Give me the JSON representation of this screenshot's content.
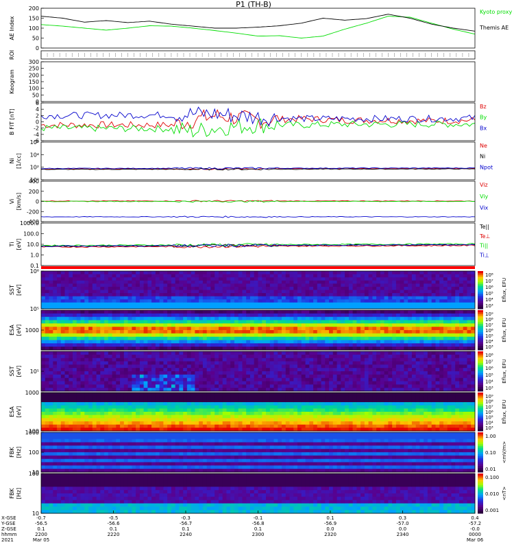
{
  "title": "P1 (TH-B)",
  "colors": {
    "kyoto": "#00dd00",
    "themis": "#000000",
    "red": "#dd0000",
    "green": "#00dd00",
    "blue": "#0000cc"
  },
  "time_axis": {
    "rows": [
      {
        "label": "X-GSE",
        "values": [
          "-0.7",
          "-0.5",
          "-0.3",
          "-0.1",
          "0.1",
          "0.3",
          "0.4"
        ]
      },
      {
        "label": "Y-GSE",
        "values": [
          "-56.5",
          "-56.6",
          "-56.7",
          "-56.8",
          "-56.9",
          "-57.0",
          "-57.2"
        ]
      },
      {
        "label": "Z-GSE",
        "values": [
          "0.1",
          "0.1",
          "0.1",
          "0.1",
          "0.0",
          "0.0",
          "-0.0"
        ]
      },
      {
        "label": "hhmm",
        "values": [
          "2200",
          "2220",
          "2240",
          "2300",
          "2320",
          "2340",
          "0000"
        ]
      },
      {
        "label": "2021",
        "values": [
          "Mar 05",
          "",
          "",
          "",
          "",
          "",
          "Mar 06"
        ]
      }
    ]
  },
  "chart_data": [
    {
      "type": "line",
      "ylabel": "AE Index",
      "ylim": [
        0,
        200
      ],
      "yticks": [
        "200",
        "150",
        "100",
        "50",
        "0"
      ],
      "series": [
        {
          "name": "Kyoto proxy AE",
          "x": [
            0,
            5,
            10,
            15,
            20,
            25,
            30,
            35,
            40,
            45,
            50,
            55,
            60,
            65,
            70,
            75,
            80,
            85,
            90,
            95,
            100
          ],
          "values": [
            118,
            110,
            100,
            90,
            100,
            112,
            110,
            100,
            88,
            75,
            60,
            62,
            50,
            60,
            95,
            125,
            160,
            155,
            125,
            95,
            70
          ]
        },
        {
          "name": "Themis AE",
          "x": [
            0,
            5,
            10,
            15,
            20,
            25,
            30,
            35,
            40,
            45,
            50,
            55,
            60,
            65,
            70,
            75,
            80,
            85,
            90,
            95,
            100
          ],
          "values": [
            160,
            150,
            130,
            138,
            128,
            135,
            120,
            110,
            100,
            100,
            105,
            112,
            125,
            150,
            140,
            148,
            170,
            150,
            120,
            100,
            85
          ]
        }
      ]
    },
    {
      "type": "line",
      "ylabel": "ROI",
      "ylim": [
        0,
        1
      ],
      "series": []
    },
    {
      "type": "heatmap",
      "ylabel": "Keogram",
      "ylim": [
        0,
        300
      ],
      "yticks": [
        "300",
        "250",
        "200",
        "150",
        "100",
        "50",
        "0"
      ]
    },
    {
      "type": "line",
      "ylabel": "B FIT [nT]",
      "ylim": [
        -6,
        6
      ],
      "yticks": [
        "6",
        "4",
        "2",
        "0",
        "-2",
        "-4",
        "-6"
      ],
      "series": [
        {
          "name": "Bz",
          "x": [
            0,
            30,
            35,
            40,
            50,
            60,
            70,
            80,
            90,
            100
          ],
          "values": [
            -1,
            -1,
            0.5,
            2,
            0.5,
            1,
            0.5,
            0.5,
            0.3,
            0.5
          ]
        },
        {
          "name": "By",
          "x": [
            0,
            30,
            35,
            40,
            50,
            60,
            70,
            80,
            90,
            100
          ],
          "values": [
            -2,
            -2.2,
            -3,
            -2,
            -1,
            -1,
            -0.8,
            -0.8,
            -0.7,
            -0.8
          ]
        },
        {
          "name": "Bx",
          "x": [
            0,
            30,
            35,
            40,
            50,
            60,
            70,
            80,
            90,
            100
          ],
          "values": [
            2,
            2.2,
            2.5,
            2.5,
            1.5,
            1,
            1,
            1,
            1,
            1.2
          ]
        }
      ]
    },
    {
      "type": "line",
      "ylabel": "Ni",
      "yunits": "[1/cc]",
      "ylim": [
        -2,
        6
      ],
      "yticks": [
        "10⁶",
        "10⁴",
        "10²",
        "10⁰"
      ],
      "series": [
        {
          "name": "Ne",
          "x": [
            0,
            100
          ],
          "values": [
            0.3,
            0.4
          ]
        },
        {
          "name": "Ni",
          "x": [
            0,
            100
          ],
          "values": [
            0.2,
            0.3
          ]
        },
        {
          "name": "Npot",
          "x": [
            0,
            100
          ],
          "values": [
            0.4,
            0.5
          ]
        }
      ]
    },
    {
      "type": "line",
      "ylabel": "Vi",
      "yunits": "[km/s]",
      "ylim": [
        -500,
        500
      ],
      "yticks": [
        "400",
        "200",
        "0",
        "-200",
        "-400"
      ],
      "series": [
        {
          "name": "Viz",
          "x": [
            0,
            100
          ],
          "values": [
            10,
            10
          ]
        },
        {
          "name": "Viy",
          "x": [
            0,
            100
          ],
          "values": [
            0,
            0
          ]
        },
        {
          "name": "Vix",
          "x": [
            0,
            100
          ],
          "values": [
            -380,
            -380
          ]
        }
      ]
    },
    {
      "type": "line",
      "ylabel": "Ti",
      "yunits": "[eV]",
      "ylim": [
        -1.5,
        4
      ],
      "yticks": [
        "1000.0",
        "100.0",
        "10.0",
        "1.0",
        "0.1"
      ],
      "series": [
        {
          "name": "Te||",
          "x": [
            0,
            100
          ],
          "values": [
            1.0,
            1.2
          ]
        },
        {
          "name": "Te⊥",
          "x": [
            0,
            100
          ],
          "values": [
            0.9,
            1.1
          ]
        },
        {
          "name": "Ti||",
          "x": [
            0,
            100
          ],
          "values": [
            1.1,
            1.3
          ]
        },
        {
          "name": "Ti⊥",
          "x": [
            0,
            100
          ],
          "values": [
            1.0,
            1.2
          ]
        }
      ]
    },
    {
      "type": "heatmap",
      "ylabel": "SST",
      "yunits": "[eV]",
      "yticks": [
        "10⁶",
        "10⁵"
      ],
      "colorbar": {
        "label": "Eflux, EFU",
        "ticks": [
          "10⁸",
          "10⁷",
          "10⁶",
          "10⁵",
          "10⁴",
          "10³"
        ]
      }
    },
    {
      "type": "heatmap",
      "ylabel": "ESA",
      "yunits": "[eV]",
      "yticks": [
        "1000"
      ],
      "colorbar": {
        "label": "Eflux, EFU",
        "ticks": [
          "10⁹",
          "10⁸",
          "10⁷",
          "10⁶",
          "10⁵",
          "10⁴",
          "10³"
        ]
      }
    },
    {
      "type": "heatmap",
      "ylabel": "SST",
      "yunits": "[eV]",
      "yticks": [
        "10⁵"
      ],
      "colorbar": {
        "label": "Eflux, EFU",
        "ticks": [
          "10⁸",
          "10⁷",
          "10⁶",
          "10⁵",
          "10⁴",
          "10³"
        ]
      }
    },
    {
      "type": "heatmap",
      "ylabel": "ESA",
      "yunits": "[eV]",
      "yticks": [
        "1000",
        "100"
      ],
      "colorbar": {
        "label": "Eflux, EFU",
        "ticks": [
          "10⁹",
          "10⁸",
          "10⁷",
          "10⁶",
          "10⁵",
          "10⁴",
          "10³"
        ]
      }
    },
    {
      "type": "heatmap",
      "ylabel": "FBK",
      "yunits": "[Hz]",
      "yticks": [
        "1000",
        "100",
        "10"
      ],
      "colorbar": {
        "label": "<mV/m>",
        "ticks": [
          "1.00",
          "0.10",
          "0.01"
        ]
      }
    },
    {
      "type": "heatmap",
      "ylabel": "FBK",
      "yunits": "[Hz]",
      "yticks": [
        "100",
        "10"
      ],
      "colorbar": {
        "label": "<nT>",
        "ticks": [
          "0.100",
          "0.010",
          "0.001"
        ]
      }
    }
  ]
}
